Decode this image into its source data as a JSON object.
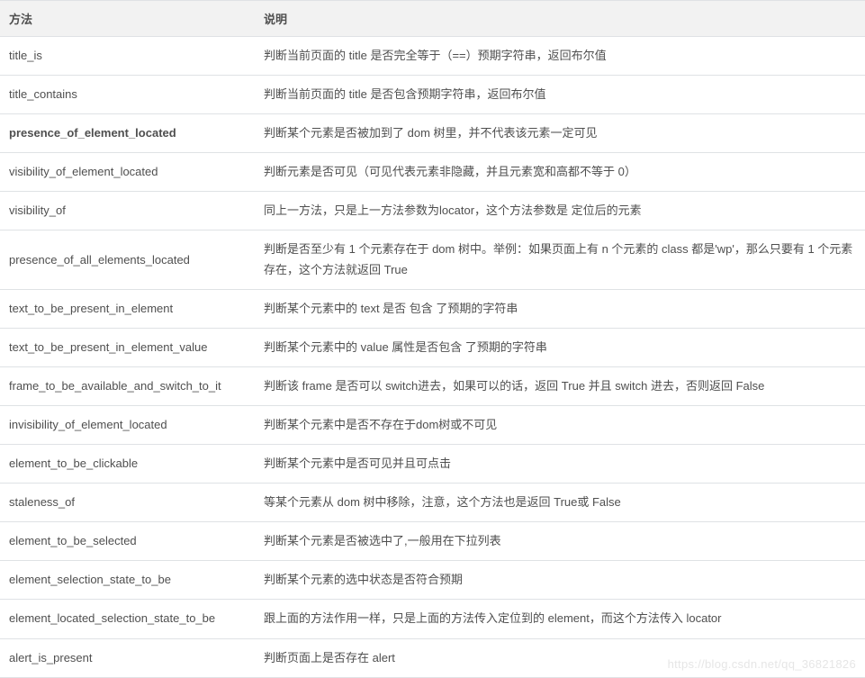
{
  "table": {
    "headers": {
      "method": "方法",
      "description": "说明"
    },
    "rows": [
      {
        "method": "title_is",
        "description": "判断当前页面的 title 是否完全等于（==）预期字符串，返回布尔值",
        "bold": false
      },
      {
        "method": "title_contains",
        "description": "判断当前页面的 title 是否包含预期字符串，返回布尔值",
        "bold": false
      },
      {
        "method": "presence_of_element_located",
        "description": "判断某个元素是否被加到了 dom 树里，并不代表该元素一定可见",
        "bold": true
      },
      {
        "method": "visibility_of_element_located",
        "description": "判断元素是否可见（可见代表元素非隐藏，并且元素宽和高都不等于 0）",
        "bold": false
      },
      {
        "method": "visibility_of",
        "description": "同上一方法，只是上一方法参数为locator，这个方法参数是 定位后的元素",
        "bold": false
      },
      {
        "method": "presence_of_all_elements_located",
        "description": "判断是否至少有 1 个元素存在于 dom 树中。举例：如果页面上有 n 个元素的 class 都是'wp'，那么只要有 1 个元素存在，这个方法就返回 True",
        "bold": false
      },
      {
        "method": "text_to_be_present_in_element",
        "description": "判断某个元素中的 text 是否 包含 了预期的字符串",
        "bold": false
      },
      {
        "method": "text_to_be_present_in_element_value",
        "description": "判断某个元素中的 value 属性是否包含 了预期的字符串",
        "bold": false
      },
      {
        "method": "frame_to_be_available_and_switch_to_it",
        "description": "判断该 frame 是否可以 switch进去，如果可以的话，返回 True 并且 switch 进去，否则返回 False",
        "bold": false
      },
      {
        "method": "invisibility_of_element_located",
        "description": "判断某个元素中是否不存在于dom树或不可见",
        "bold": false
      },
      {
        "method": "element_to_be_clickable",
        "description": "判断某个元素中是否可见并且可点击",
        "bold": false
      },
      {
        "method": "staleness_of",
        "description": "等某个元素从 dom 树中移除，注意，这个方法也是返回 True或 False",
        "bold": false
      },
      {
        "method": "element_to_be_selected",
        "description": "判断某个元素是否被选中了,一般用在下拉列表",
        "bold": false
      },
      {
        "method": "element_selection_state_to_be",
        "description": "判断某个元素的选中状态是否符合预期",
        "bold": false
      },
      {
        "method": "element_located_selection_state_to_be",
        "description": "跟上面的方法作用一样，只是上面的方法传入定位到的 element，而这个方法传入 locator",
        "bold": false
      },
      {
        "method": "alert_is_present",
        "description": "判断页面上是否存在 alert",
        "bold": false
      }
    ]
  },
  "watermark": "https://blog.csdn.net/qq_36821826"
}
